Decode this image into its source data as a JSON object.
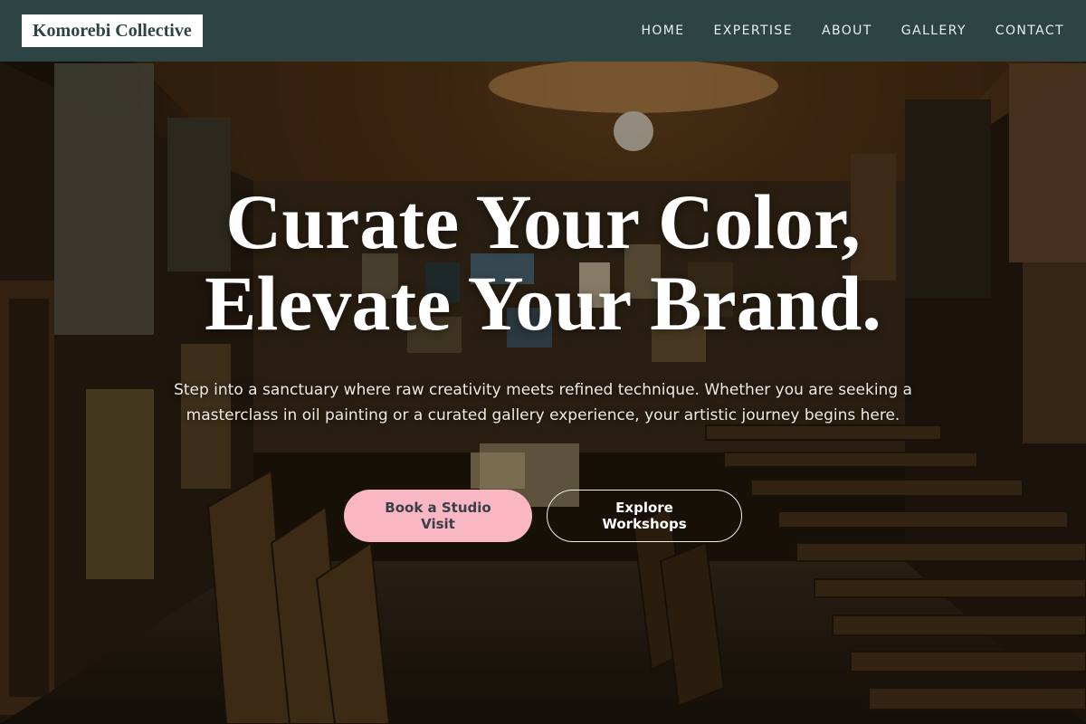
{
  "brand": {
    "name": "Komorebi Collective"
  },
  "nav": {
    "items": [
      {
        "label": "HOME"
      },
      {
        "label": "EXPERTISE"
      },
      {
        "label": "ABOUT"
      },
      {
        "label": "GALLERY"
      },
      {
        "label": "CONTACT"
      }
    ]
  },
  "hero": {
    "headline_line1": "Curate Your Color,",
    "headline_line2": "Elevate Your Brand.",
    "subtext": "Step into a sanctuary where raw creativity meets refined technique. Whether you are seeking a masterclass in oil painting or a curated gallery experience, your artistic journey begins here.",
    "primary_cta": "Book a Studio Visit",
    "secondary_cta": "Explore Workshops"
  },
  "colors": {
    "nav_background": "#2c4443",
    "primary_button": "#f9b7c4",
    "text_light": "#ffffff"
  }
}
